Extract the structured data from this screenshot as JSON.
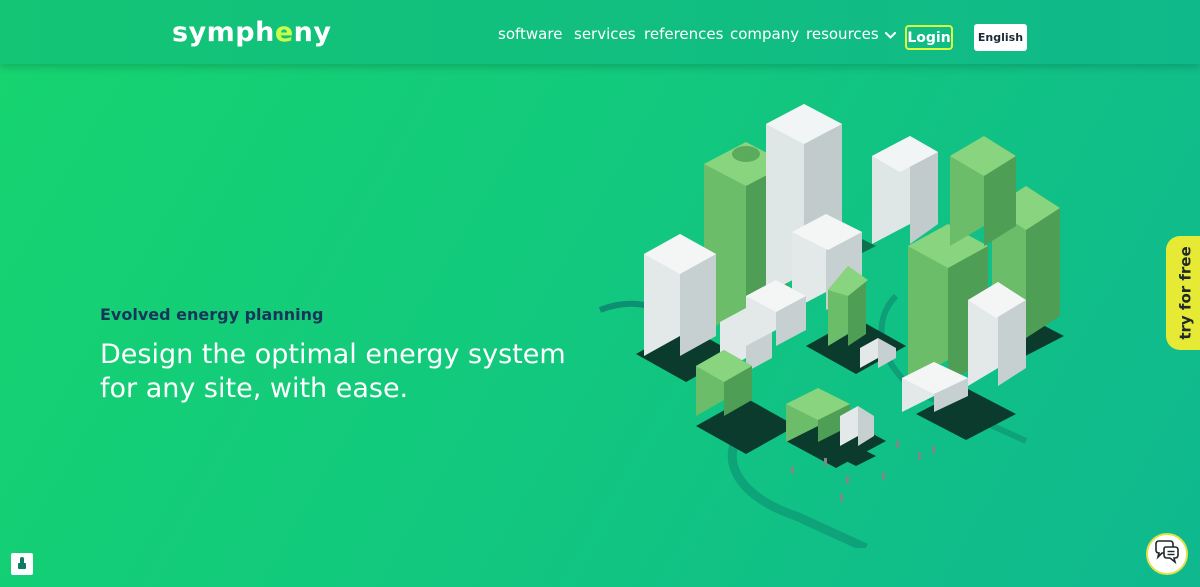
{
  "header": {
    "logo_before": "symph",
    "logo_accent": "e",
    "logo_after": "ny",
    "nav": {
      "software": "software",
      "services": "services",
      "references": "references",
      "company": "company",
      "resources": "resources"
    },
    "login_label": "Login",
    "language_label": "English"
  },
  "hero": {
    "eyebrow": "Evolved energy planning",
    "headline": "Design the optimal energy system for any site, with ease."
  },
  "cta": {
    "try_label": "try for free"
  },
  "icons": {
    "resources": "chevron-down-icon",
    "chat": "chat-bubbles-icon",
    "privacy": "lock-icon"
  },
  "colors": {
    "brand_green": "#17d46f",
    "header_teal": "#10b98a",
    "accent_lime": "#c8ff4a",
    "cta_yellow": "#e7ea34",
    "eyebrow_navy": "#163659"
  }
}
